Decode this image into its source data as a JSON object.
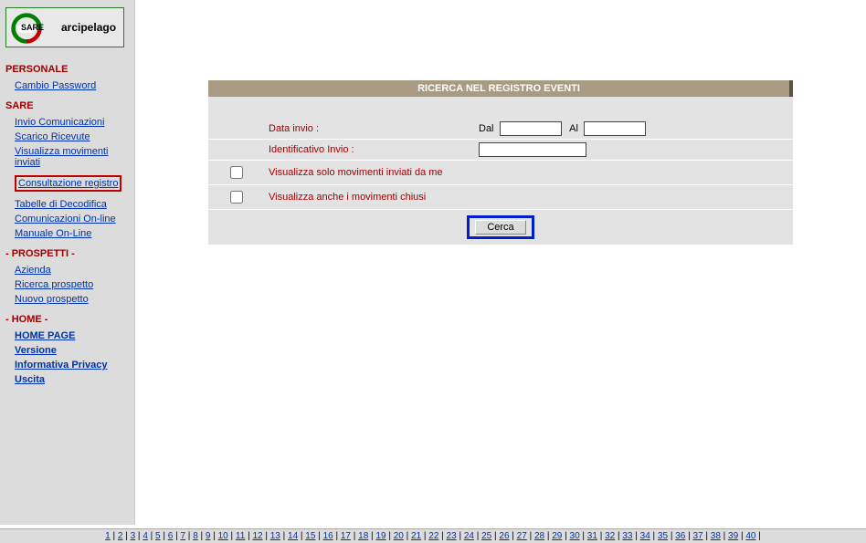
{
  "logo": {
    "badge": "SARE",
    "text": "arcipelago"
  },
  "sidebar": {
    "sections": [
      {
        "title": "PERSONALE",
        "items": [
          {
            "label": "Cambio Password",
            "bold": false,
            "highlight": false
          }
        ]
      },
      {
        "title": "SARE",
        "items": [
          {
            "label": "Invio Comunicazioni",
            "bold": false,
            "highlight": false
          },
          {
            "label": "Scarico Ricevute",
            "bold": false,
            "highlight": false
          },
          {
            "label": "Visualizza movimenti inviati",
            "bold": false,
            "highlight": false
          },
          {
            "label": "Consultazione registro",
            "bold": false,
            "highlight": true
          },
          {
            "label": "Tabelle di Decodifica",
            "bold": false,
            "highlight": false
          },
          {
            "label": "Comunicazioni On-line",
            "bold": false,
            "highlight": false
          },
          {
            "label": "Manuale On-Line",
            "bold": false,
            "highlight": false
          }
        ]
      },
      {
        "title": "- PROSPETTI -",
        "items": [
          {
            "label": "Azienda",
            "bold": false,
            "highlight": false
          },
          {
            "label": "Ricerca prospetto",
            "bold": false,
            "highlight": false
          },
          {
            "label": "Nuovo prospetto",
            "bold": false,
            "highlight": false
          }
        ]
      },
      {
        "title": "- HOME -",
        "items": [
          {
            "label": "HOME PAGE",
            "bold": true,
            "highlight": false
          },
          {
            "label": "Versione",
            "bold": true,
            "highlight": false
          },
          {
            "label": "Informativa Privacy",
            "bold": true,
            "highlight": false
          },
          {
            "label": "Uscita",
            "bold": true,
            "highlight": false
          }
        ]
      }
    ]
  },
  "form": {
    "title": "RICERCA NEL REGISTRO EVENTI",
    "row_data_invio_label": "Data invio :",
    "dal_label": "Dal",
    "dal_value": "",
    "al_label": "Al",
    "al_value": "",
    "row_identificativo_label": "Identificativo Invio :",
    "identificativo_value": "",
    "row_solo_movimenti_label": "Visualizza solo movimenti inviati da me",
    "row_movimenti_chiusi_label": "Visualizza anche i movimenti chiusi",
    "search_button": "Cerca"
  },
  "footer": {
    "pages": [
      "1",
      "2",
      "3",
      "4",
      "5",
      "6",
      "7",
      "8",
      "9",
      "10",
      "11",
      "12",
      "13",
      "14",
      "15",
      "16",
      "17",
      "18",
      "19",
      "20",
      "21",
      "22",
      "23",
      "24",
      "25",
      "26",
      "27",
      "28",
      "29",
      "30",
      "31",
      "32",
      "33",
      "34",
      "35",
      "36",
      "37",
      "38",
      "39",
      "40"
    ]
  }
}
